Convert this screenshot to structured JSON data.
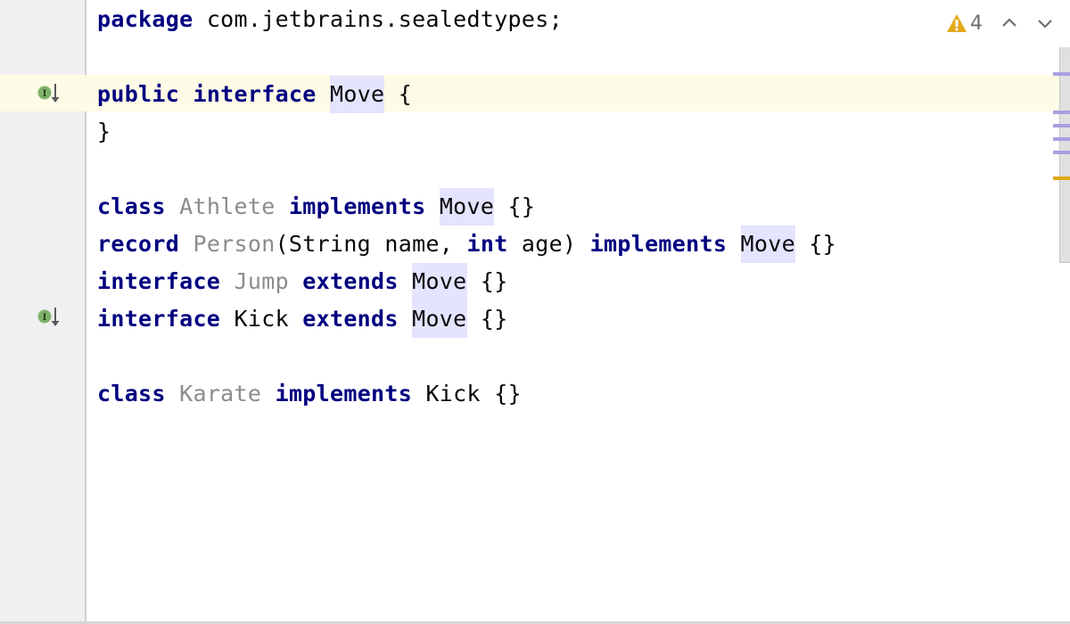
{
  "editor": {
    "package_line": {
      "keyword": "package",
      "name": "com.jetbrains.sealedtypes;"
    },
    "lines": [
      {
        "parts": [
          {
            "t": "public",
            "c": "kw"
          },
          {
            "t": " "
          },
          {
            "t": "interface",
            "c": "kw"
          },
          {
            "t": " "
          },
          {
            "t": "Move",
            "c": "hl"
          },
          {
            "t": " {"
          }
        ]
      },
      {
        "parts": [
          {
            "t": "}"
          }
        ]
      },
      {
        "parts": []
      },
      {
        "parts": [
          {
            "t": "class",
            "c": "kw"
          },
          {
            "t": " "
          },
          {
            "t": "Athlete",
            "c": "dim"
          },
          {
            "t": " "
          },
          {
            "t": "implements",
            "c": "kw"
          },
          {
            "t": " "
          },
          {
            "t": "Move",
            "c": "hl"
          },
          {
            "t": " {}"
          }
        ]
      },
      {
        "parts": [
          {
            "t": "record",
            "c": "kw"
          },
          {
            "t": " "
          },
          {
            "t": "Person",
            "c": "dim"
          },
          {
            "t": "(String name, "
          },
          {
            "t": "int",
            "c": "kw"
          },
          {
            "t": " age) "
          },
          {
            "t": "implements",
            "c": "kw"
          },
          {
            "t": " "
          },
          {
            "t": "Move",
            "c": "hl"
          },
          {
            "t": " {}"
          }
        ]
      },
      {
        "parts": [
          {
            "t": "interface",
            "c": "kw"
          },
          {
            "t": " "
          },
          {
            "t": "Jump",
            "c": "dim"
          },
          {
            "t": " "
          },
          {
            "t": "extends",
            "c": "kw"
          },
          {
            "t": " "
          },
          {
            "t": "Move",
            "c": "hl"
          },
          {
            "t": " {}"
          }
        ]
      },
      {
        "parts": [
          {
            "t": "interface",
            "c": "kw"
          },
          {
            "t": " Kick "
          },
          {
            "t": "extends",
            "c": "kw"
          },
          {
            "t": " "
          },
          {
            "t": "Move",
            "c": "hl"
          },
          {
            "t": " {}"
          }
        ]
      },
      {
        "parts": []
      },
      {
        "parts": [
          {
            "t": "class",
            "c": "kw"
          },
          {
            "t": " "
          },
          {
            "t": "Karate",
            "c": "dim"
          },
          {
            "t": " "
          },
          {
            "t": "implements",
            "c": "kw"
          },
          {
            "t": " Kick {}"
          }
        ]
      }
    ]
  },
  "gutter_icons": [
    {
      "icon": "implemented-interface-icon",
      "label": "I",
      "line": "public interface Move"
    },
    {
      "icon": "implemented-interface-icon",
      "label": "I",
      "line": "interface Kick"
    }
  ],
  "inspections": {
    "warning_count": "4",
    "warning_icon": "warning-triangle-icon",
    "prev_icon": "chevron-up-icon",
    "next_icon": "chevron-down-icon"
  },
  "colors": {
    "keyword": "#000080",
    "unused": "#8c8c8c",
    "usage_highlight": "#e4e4ff",
    "caret_row": "#fefbe6",
    "warning": "#e3a91b",
    "gutter_icon": "#7db36a"
  }
}
